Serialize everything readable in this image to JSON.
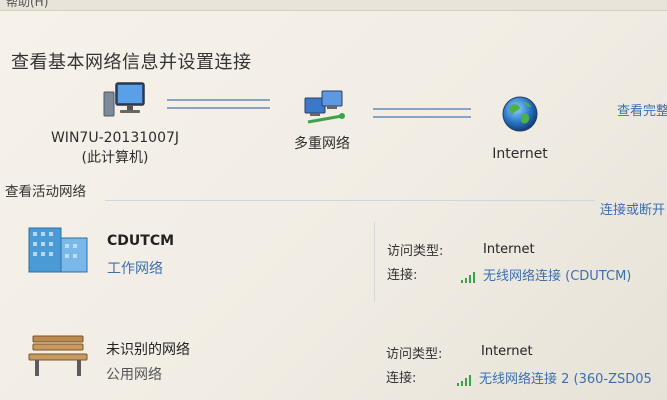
{
  "menubar": {
    "text": "帮助(H)"
  },
  "page": {
    "heading": "查看基本网络信息并设置连接",
    "view_full_map": "查看完整"
  },
  "network_map": {
    "computer": {
      "name": "WIN7U-20131007J",
      "sub": "(此计算机)"
    },
    "middle": {
      "name": "多重网络"
    },
    "internet": {
      "name": "Internet"
    }
  },
  "active": {
    "title": "查看活动网络",
    "connect_link": "连接或断开"
  },
  "networks": [
    {
      "name": "CDUTCM",
      "type": "工作网络",
      "access_label": "访问类型:",
      "access_value": "Internet",
      "conn_label": "连接:",
      "conn_value": "无线网络连接 (CDUTCM)"
    },
    {
      "name": "未识别的网络",
      "type": "公用网络",
      "access_label": "访问类型:",
      "access_value": "Internet",
      "conn_label": "连接:",
      "conn_value": "无线网络连接 2 (360-ZSD05"
    }
  ],
  "colors": {
    "link": "#3a6fb0",
    "signal": "#3aa34a"
  }
}
